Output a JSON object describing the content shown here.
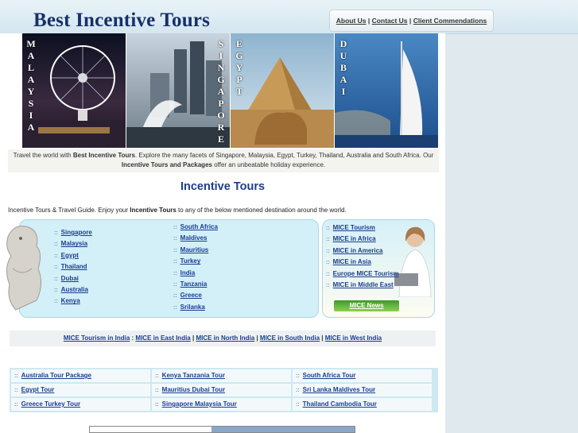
{
  "brand": "Best Incentive Tours",
  "topnav": {
    "about": "About Us",
    "contact": "Contact Us",
    "commend": "Client Commendations",
    "sep": "|"
  },
  "banner": {
    "malaysia": [
      "M",
      "A",
      "L",
      "A",
      "Y",
      "S",
      "I",
      "A"
    ],
    "singapore": [
      "S",
      "I",
      "N",
      "G",
      "A",
      "P",
      "O",
      "R",
      "E"
    ],
    "egypt": [
      "E",
      "G",
      "Y",
      "P",
      "T"
    ],
    "dubai": [
      "D",
      "U",
      "B",
      "A",
      "I"
    ]
  },
  "intro": {
    "p1": "Travel the world with ",
    "b1": "Best Incentive Tours",
    "p2": ". Explore the many facets of Singapore, Malaysia, Egypt, Turkey, Thailand, Australia and South Africa. Our ",
    "b2": "Incentive Tours and Packages",
    "p3": " offer an unbeatable holiday experience."
  },
  "heading": "Incentive Tours",
  "guide": {
    "p1": "Incentive Tours & Travel Guide. Enjoy your ",
    "b": "Incentive Tours",
    "p2": " to any of the below mentioned destination around the world."
  },
  "bullet": "::",
  "dest_left": [
    "Singapore",
    "Malaysia",
    "Egypt",
    "Thailand",
    "Dubai",
    "Australia",
    "Kenya"
  ],
  "dest_right": [
    "South Africa",
    "Maldives",
    "Mauritius",
    "Turkey",
    "India",
    "Tanzania",
    "Greece",
    "Srilanka"
  ],
  "mice_links": [
    "MICE Tourism",
    "MICE in Africa",
    "MICE in America",
    "MICE in Asia",
    "Europe MICE Tourism",
    "MICE in Middle East"
  ],
  "mice_news": "MICE News",
  "regions": [
    "MICE Tourism in India",
    "MICE in East India",
    "MICE in North India",
    "MICE in South India",
    "MICE in West India"
  ],
  "region_seps": [
    " : ",
    " | ",
    " | ",
    " | "
  ],
  "packages": [
    [
      "Australia Tour Package",
      "Kenya Tanzania Tour",
      "South Africa Tour"
    ],
    [
      "Egypt Tour",
      "Mauritius Dubai Tour",
      "Sri Lanka Maldives Tour"
    ],
    [
      "Greece Turkey Tour",
      "Singapore Malaysia Tour",
      "Thailand Cambodia Tour"
    ]
  ]
}
